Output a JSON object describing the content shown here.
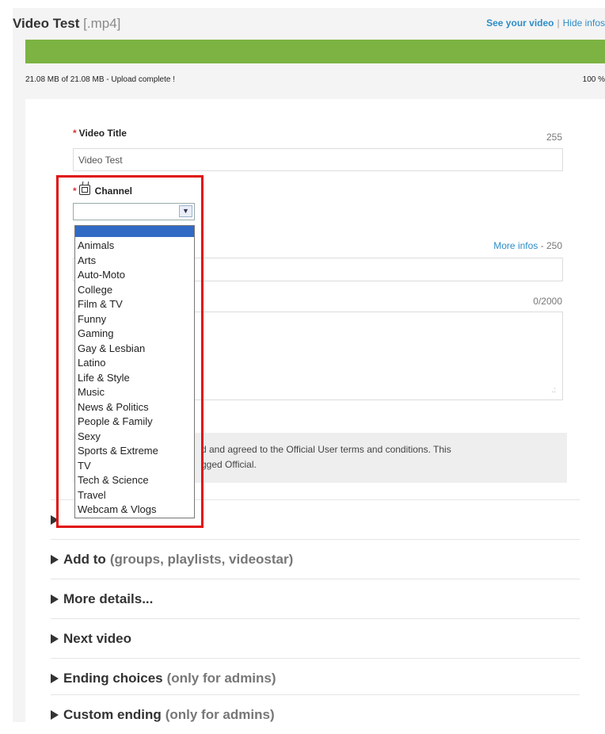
{
  "header": {
    "title": "Video Test",
    "extension": "[.mp4]",
    "see_video_link": "See your video",
    "separator": "|",
    "hide_infos_link": "Hide infos"
  },
  "upload": {
    "status": "21.08 MB of 21.08 MB - Upload complete !",
    "percent_label": "100 %",
    "progress_fraction": 1.0,
    "progress_color": "#7cb342"
  },
  "form": {
    "video_title_label": "Video Title",
    "video_title_count": "255",
    "video_title_value": "Video Test",
    "required_marker": "*",
    "channel_label": "Channel",
    "channel_selected": "",
    "more_infos_link": "More infos",
    "tags_count": "- 250",
    "description_count": "0/2000",
    "resize_glyph": ".:",
    "terms_line1": "d and agreed to the Official User terms and conditions. This",
    "terms_line2": "gged Official."
  },
  "channel_options": [
    "Animals",
    "Arts",
    "Auto-Moto",
    "College",
    "Film & TV",
    "Funny",
    "Gaming",
    "Gay & Lesbian",
    "Latino",
    "Life & Style",
    "Music",
    "News & Politics",
    "People & Family",
    "Sexy",
    "Sports & Extreme",
    "TV",
    "Tech & Science",
    "Travel",
    "Webcam & Vlogs"
  ],
  "sections": {
    "add_to": {
      "label": "Add to",
      "note": "(groups, playlists, videostar)"
    },
    "more_details": {
      "label": "More details..."
    },
    "next_video": {
      "label": "Next video"
    },
    "ending_choices": {
      "label": "Ending choices",
      "note": "(only for admins)"
    },
    "custom_ending": {
      "label": "Custom ending",
      "note": "(only for admins)"
    }
  },
  "colors": {
    "accent_link": "#2e8dc8",
    "highlight_border": "#e01010",
    "selection": "#316ac5"
  }
}
